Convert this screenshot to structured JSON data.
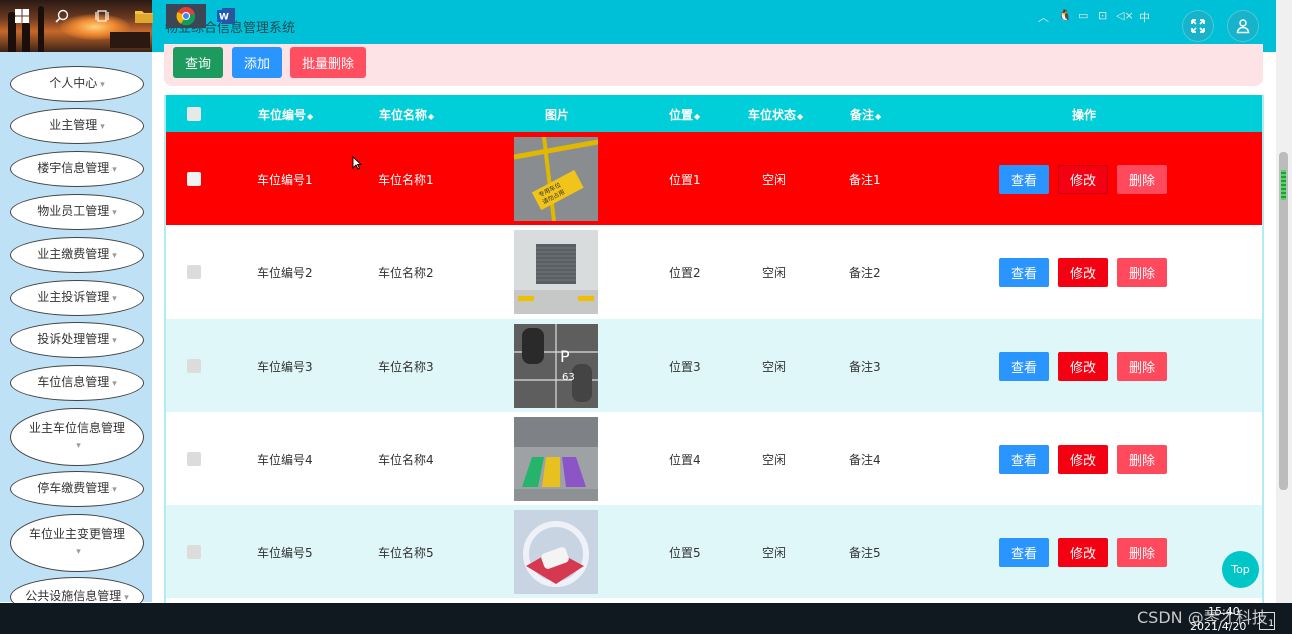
{
  "app": {
    "title": "物业综合信息管理系统"
  },
  "header": {
    "fullscreen_icon": "fullscreen-icon",
    "user_icon": "user-icon"
  },
  "sidebar": {
    "items": [
      {
        "label": "个人中心"
      },
      {
        "label": "业主管理"
      },
      {
        "label": "楼宇信息管理"
      },
      {
        "label": "物业员工管理"
      },
      {
        "label": "业主缴费管理"
      },
      {
        "label": "业主投诉管理"
      },
      {
        "label": "投诉处理管理"
      },
      {
        "label": "车位信息管理"
      },
      {
        "label": "业主车位信息管理"
      },
      {
        "label": "停车缴费管理"
      },
      {
        "label": "车位业主变更管理"
      },
      {
        "label": "公共设施信息管理"
      }
    ]
  },
  "toolbar": {
    "query": "查询",
    "add": "添加",
    "batch_delete": "批量删除"
  },
  "table": {
    "headers": {
      "code": "车位编号",
      "name": "车位名称",
      "image": "图片",
      "position": "位置",
      "status": "车位状态",
      "remark": "备注",
      "actions": "操作"
    },
    "rows": [
      {
        "code": "车位编号1",
        "name": "车位名称1",
        "position": "位置1",
        "status": "空闲",
        "remark": "备注1",
        "selected": true
      },
      {
        "code": "车位编号2",
        "name": "车位名称2",
        "position": "位置2",
        "status": "空闲",
        "remark": "备注2"
      },
      {
        "code": "车位编号3",
        "name": "车位名称3",
        "position": "位置3",
        "status": "空闲",
        "remark": "备注3"
      },
      {
        "code": "车位编号4",
        "name": "车位名称4",
        "position": "位置4",
        "status": "空闲",
        "remark": "备注4"
      },
      {
        "code": "车位编号5",
        "name": "车位名称5",
        "position": "位置5",
        "status": "空闲",
        "remark": "备注5"
      }
    ],
    "actions": {
      "view": "查看",
      "edit": "修改",
      "delete": "删除"
    },
    "row_colors": {
      "selected": "#ff0000",
      "odd": "#ffffff",
      "even": "#e0f7fa"
    }
  },
  "back_to_top": "Top",
  "taskbar": {
    "time": "15:40",
    "date": "2021/4/20",
    "tray_lang": "中",
    "notification_count": "1"
  },
  "watermark": "CSDN @琴才科技"
}
